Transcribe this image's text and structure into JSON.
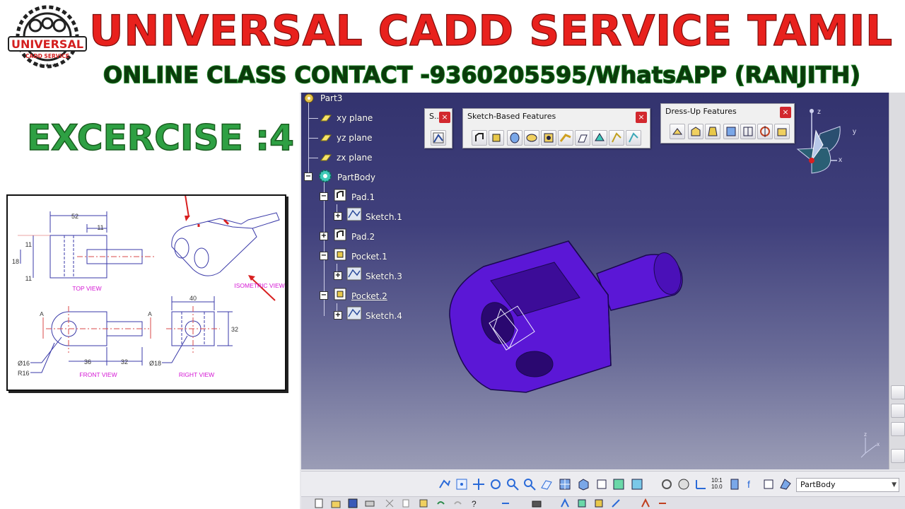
{
  "banner": {
    "logo_text": "UNIVERSAL",
    "logo_subtext": "CADD SERVICE",
    "title": "UNIVERSAL CADD SERVICE TAMIL",
    "subtitle": "ONLINE CLASS CONTACT -9360205595/WhatsAPP (RANJITH)"
  },
  "exercise": {
    "title": "EXCERCISE :4"
  },
  "drawing": {
    "views": {
      "top": "TOP VIEW",
      "front": "FRONT VIEW",
      "right": "RIGHT VIEW",
      "iso": "ISOMETRIC VIEW"
    },
    "dims": {
      "d52": "52",
      "d11a": "11",
      "d11b": "11",
      "d18": "18",
      "d11c": "11",
      "d40": "40",
      "d32v": "32",
      "d36": "36",
      "d32h": "32",
      "phi16": "Ø16",
      "r16": "R16",
      "phi18": "Ø18",
      "secA1": "A",
      "secA2": "A"
    }
  },
  "tree": {
    "items": [
      {
        "label": "Part3",
        "icon": "part-gear-icon"
      },
      {
        "label": "xy plane",
        "icon": "plane-icon"
      },
      {
        "label": "yz plane",
        "icon": "plane-icon"
      },
      {
        "label": "zx plane",
        "icon": "plane-icon"
      },
      {
        "label": "PartBody",
        "icon": "body-gear-icon"
      },
      {
        "label": "Pad.1",
        "icon": "pad-icon"
      },
      {
        "label": "Sketch.1",
        "icon": "sketch-icon"
      },
      {
        "label": "Pad.2",
        "icon": "pad-icon"
      },
      {
        "label": "Pocket.1",
        "icon": "pocket-icon"
      },
      {
        "label": "Sketch.3",
        "icon": "sketch-icon"
      },
      {
        "label": "Pocket.2",
        "icon": "pocket-icon"
      },
      {
        "label": "Sketch.4",
        "icon": "sketch-icon"
      }
    ]
  },
  "toolbars": {
    "small_title": "S...",
    "sketch_based_title": "Sketch-Based Features",
    "dress_up_title": "Dress-Up Features",
    "close_glyph": "×"
  },
  "compass": {
    "x": "x",
    "y": "y",
    "z": "z"
  },
  "axis_mini": {
    "x": "x",
    "z": "z"
  },
  "bottom": {
    "zoom_ratio": "10:1\n10.0",
    "body_select": "PartBody",
    "select_arrow": "▼"
  },
  "colors": {
    "title_red": "#e8211d",
    "subtitle_green": "#1f8a2a",
    "part_purple": "#5b17d6",
    "viewport_top": "#33336e"
  }
}
